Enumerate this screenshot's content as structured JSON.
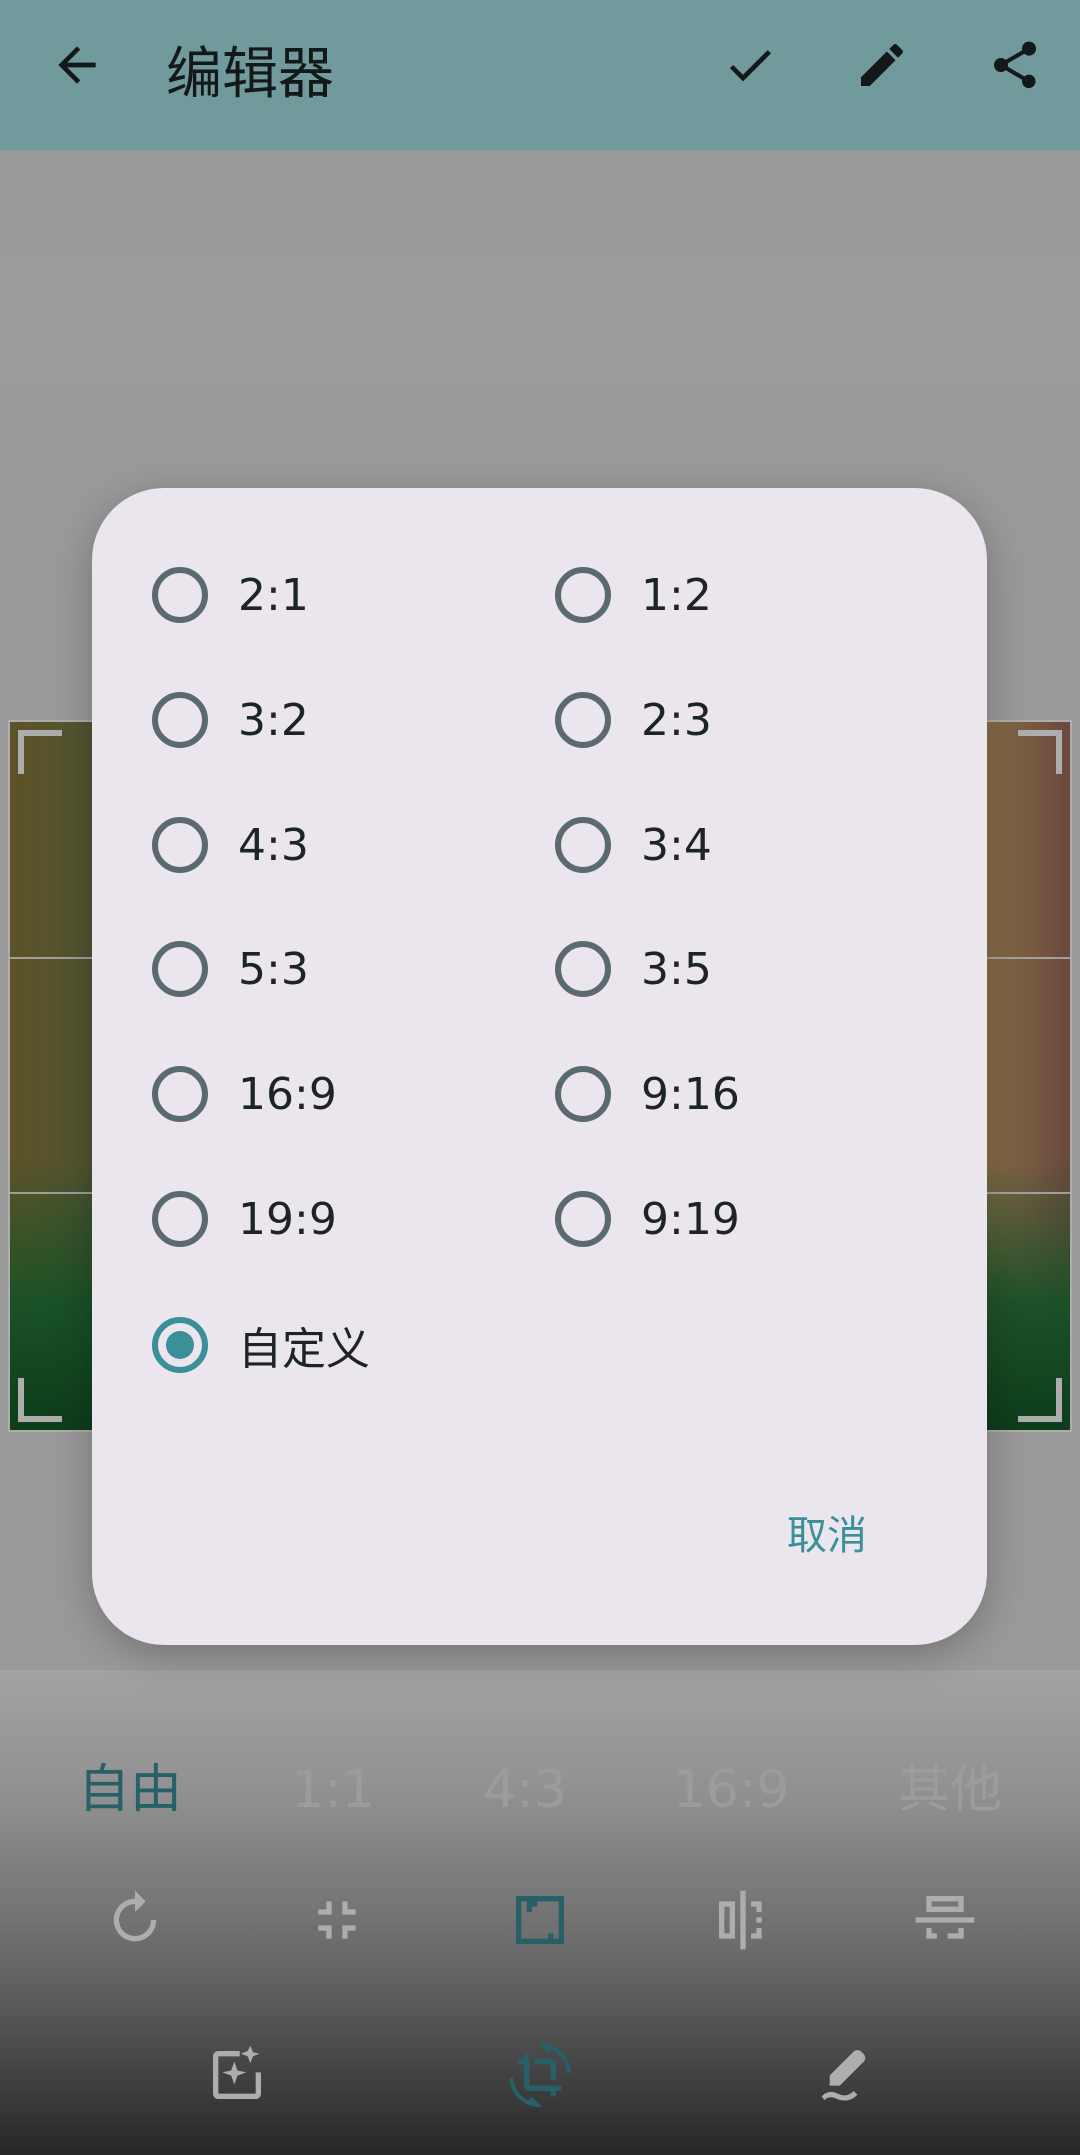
{
  "app_bar": {
    "title": "编辑器",
    "back_icon": "arrow-back-icon",
    "confirm_icon": "check-icon",
    "edit_icon": "pencil-icon",
    "share_icon": "share-icon",
    "background": "#a7e3e6"
  },
  "crop_ratios": {
    "items": [
      "自由",
      "1:1",
      "4:3",
      "16:9",
      "其他"
    ],
    "active": "自由"
  },
  "tool_icons": [
    "rotate-icon",
    "shrink-icon",
    "fit-icon",
    "flip-horizontal-icon",
    "flip-vertical-icon"
  ],
  "mode_icons": [
    "enhance-icon",
    "crop-rotate-icon",
    "draw-icon"
  ],
  "dialog": {
    "options_left": [
      "2:1",
      "3:2",
      "4:3",
      "5:3",
      "16:9",
      "19:9"
    ],
    "options_right": [
      "1:2",
      "2:3",
      "3:4",
      "3:5",
      "9:16",
      "9:19"
    ],
    "custom_option": "自定义",
    "selected": "自定义",
    "cancel_label": "取消",
    "accent": "#3a8f98",
    "background": "#ebe6ee"
  }
}
